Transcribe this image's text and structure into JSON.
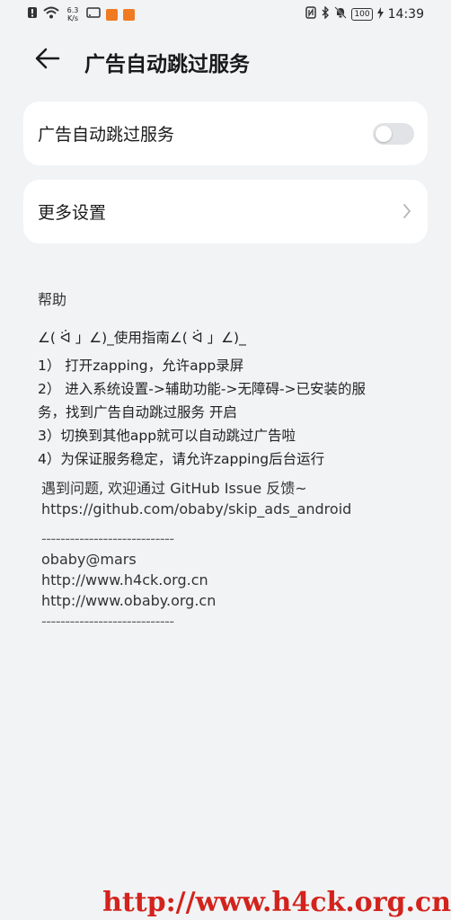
{
  "status_bar": {
    "net_speed_value": "6.3",
    "net_speed_unit": "K/s",
    "battery": "100",
    "time": "14:39"
  },
  "header": {
    "title": "广告自动跳过服务"
  },
  "settings": {
    "service_toggle_label": "广告自动跳过服务",
    "toggle_on": false,
    "more_settings_label": "更多设置"
  },
  "help": {
    "heading": "帮助",
    "guide_title": "∠( ᐛ 」∠)_使用指南∠( ᐛ 」∠)_",
    "steps": [
      "1） 打开zapping，允许app录屏",
      "2） 进入系统设置->辅助功能->无障碍->已安装的服",
      "务，找到广告自动跳过服务 开启",
      "3）切换到其他app就可以自动跳过广告啦",
      "4）为保证服务稳定，请允许zapping后台运行"
    ],
    "feedback": "遇到问题, 欢迎通过 GitHub Issue 反馈~",
    "repo_url": "https://github.com/obaby/skip_ads_android",
    "divider": "----------------------------",
    "author": "obaby@mars",
    "site1": "http://www.h4ck.org.cn",
    "site2": "http://www.obaby.org.cn"
  },
  "watermark": "http://www.h4ck.org.cn",
  "colors": {
    "background": "#f1f3f5",
    "card": "#ffffff",
    "toggle_off": "#e2e3e6",
    "watermark": "#d2231c"
  }
}
